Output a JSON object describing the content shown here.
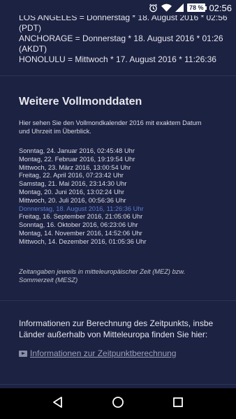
{
  "status_bar": {
    "battery": "78 %",
    "time": "02:56"
  },
  "timezones": [
    {
      "line": "LOS ANGELES = Donnerstag * 18. August 2016 * 02:56",
      "zone": "(PDT)"
    },
    {
      "line": "ANCHORAGE = Donnerstag * 18. August 2016 * 01:26",
      "zone": "(AKDT)"
    },
    {
      "line": "HONOLULU = Mittwoch * 17. August 2016 * 11:26:36",
      "zone": ""
    }
  ],
  "section": {
    "title": "Weitere Vollmonddaten",
    "intro_line1": "Hier sehen Sie den Vollmondkalender 2016 mit exaktem Datum",
    "intro_line2": "und Uhrzeit im Überblick."
  },
  "full_moon_dates": [
    {
      "text": "Sonntag, 24. Januar 2016, 02:45:48 Uhr",
      "highlighted": false
    },
    {
      "text": "Montag, 22. Februar 2016, 19:19:54 Uhr",
      "highlighted": false
    },
    {
      "text": "Mittwoch, 23. März 2016, 13:00:54 Uhr",
      "highlighted": false
    },
    {
      "text": "Freitag, 22. April 2016, 07:23:42 Uhr",
      "highlighted": false
    },
    {
      "text": "Samstag, 21. Mai 2016, 23:14:30 Uhr",
      "highlighted": false
    },
    {
      "text": "Montag, 20. Juni 2016, 13:02:24 Uhr",
      "highlighted": false
    },
    {
      "text": "Mittwoch, 20. Juli 2016, 00:56:36 Uhr",
      "highlighted": false
    },
    {
      "text": "Donnerstag, 18. August 2016, 11:26:36 Uhr",
      "highlighted": true
    },
    {
      "text": "Freitag, 16. September 2016, 21:05:06 Uhr",
      "highlighted": false
    },
    {
      "text": "Sonntag, 16. Oktober 2016, 06:23:06 Uhr",
      "highlighted": false
    },
    {
      "text": "Montag, 14. November 2016, 14:52:06 Uhr",
      "highlighted": false
    },
    {
      "text": "Mittwoch, 14. Dezember 2016, 01:05:36 Uhr",
      "highlighted": false
    }
  ],
  "note": {
    "line1": "Zeitangaben jeweils in mitteleuropäischer Zeit (MEZ) bzw.",
    "line2": "Sommerzeit (MESZ)"
  },
  "info": {
    "line1": "Informationen zur Berechnung des Zeitpunkts, insbe",
    "line2": "Länder außerhalb von Mitteleuropa finden Sie hier:",
    "link_label": "Informationen zur Zeitpunktberechnung"
  },
  "colors": {
    "background": "#1c2242",
    "highlight": "#5b7bd6",
    "navbar": "#000000"
  },
  "icons": [
    "alarm-icon",
    "wifi-icon",
    "signal-icon",
    "battery-icon",
    "back-icon",
    "home-icon",
    "recents-icon",
    "video-link-icon"
  ]
}
